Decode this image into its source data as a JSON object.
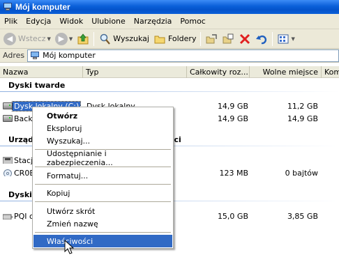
{
  "window": {
    "title": "Mój komputer"
  },
  "menu": [
    "Plik",
    "Edycja",
    "Widok",
    "Ulubione",
    "Narzędzia",
    "Pomoc"
  ],
  "toolbar": {
    "back_label": "Wstecz",
    "search_label": "Wyszukaj",
    "folders_label": "Foldery"
  },
  "address": {
    "label": "Adres",
    "value": "Mój komputer"
  },
  "columns": [
    "Nazwa",
    "Typ",
    "Całkowity roz...",
    "Wolne miejsce",
    "Kom"
  ],
  "groups": {
    "hard_drives": "Dyski twarde",
    "removable_partial": "Urząd",
    "removable_tail": "ęci",
    "other_partial": "Dyski"
  },
  "rows": [
    {
      "name": "Dysk lokalny (C:)",
      "type": "Dysk lokalny",
      "total": "14,9 GB",
      "free": "11,2 GB",
      "selected": true
    },
    {
      "name": "Backu",
      "type": "",
      "total": "14,9 GB",
      "free": "14,9 GB"
    },
    {
      "name": "Stacja",
      "type": "",
      "total": "",
      "free": ""
    },
    {
      "name": "CR0E",
      "type": "",
      "total": "123 MB",
      "free": "0 bajtów"
    },
    {
      "name": "PQI o",
      "type": "",
      "total": "15,0 GB",
      "free": "3,85 GB"
    }
  ],
  "context_menu": [
    "Otwórz",
    "Eksploruj",
    "Wyszukaj...",
    "Udostępnianie i zabezpieczenia...",
    "Formatuj...",
    "Kopiuj",
    "Utwórz skrót",
    "Zmień nazwę",
    "Właściwości"
  ],
  "colors": {
    "title_bar": "#0a5fd8",
    "selection": "#316ac5",
    "chrome": "#ece9d8"
  }
}
